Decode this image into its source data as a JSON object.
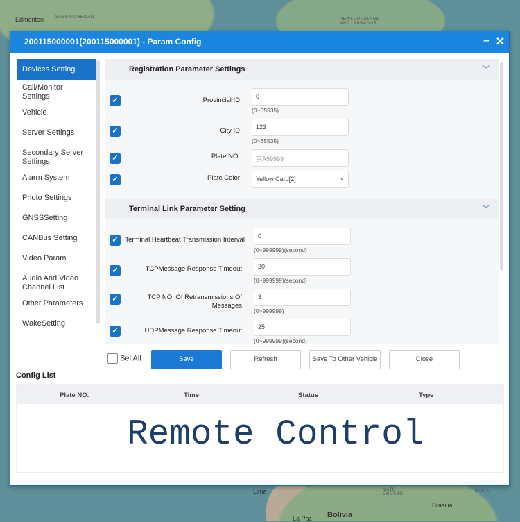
{
  "map": {
    "labels": [
      "Edmonton",
      "SASKATCHEWAN",
      "NEWFOUNDLAND AND LABRADOR",
      "Lima",
      "MATO GROSSO",
      "Brasilia",
      "Bolivia",
      "La Paz",
      "BAHIA"
    ]
  },
  "dialog": {
    "title": "200115000001(200115000001) - Param Config",
    "minimize": "–",
    "close": "✕"
  },
  "sidebar": {
    "items": [
      "Devices Setting",
      "Call/Monitor Settings",
      "Vehicle",
      "Server Settings",
      "Secondary Server Settings",
      "Alarm System",
      "Photo Settings",
      "GNSSSetting",
      "CANBus Setting",
      "Video Param",
      "Audio And Video Channel List",
      "Other Parameters",
      "WakeSetting"
    ]
  },
  "sections": [
    {
      "title": "Registration Parameter Settings",
      "fields": [
        {
          "label": "Provincial ID",
          "value": "0",
          "hint": "(0~65535)",
          "checked": true
        },
        {
          "label": "City ID",
          "value": "123",
          "hint": "(0~65535)",
          "checked": true
        },
        {
          "label": "Plate NO.",
          "value": "京A99999",
          "hint": "",
          "checked": true
        },
        {
          "label": "Plate Color",
          "value": "Yellow Card[2]",
          "hint": "",
          "checked": true
        }
      ]
    },
    {
      "title": "Terminal Link Parameter Setting",
      "fields": [
        {
          "label": "Terminal Heartbeat Transmission Interval",
          "value": "0",
          "hint": "(0~999999)(second)",
          "checked": true
        },
        {
          "label": "TCPMessage Response Timeout",
          "value": "20",
          "hint": "(0~999999)(second)",
          "checked": true
        },
        {
          "label": "TCP NO. Of Retransmissions Of Messages",
          "value": "3",
          "hint": "(0~999999)",
          "checked": true
        },
        {
          "label": "UDPMessage Response Timeout",
          "value": "25",
          "hint": "(0~999999)(second)",
          "checked": true
        }
      ]
    }
  ],
  "actions": {
    "sel_all": "Sel All",
    "save": "Save",
    "refresh": "Refresh",
    "save_other": "Save To Other Vehicle",
    "close": "Close"
  },
  "config_list": {
    "title": "Config List",
    "columns": [
      "Plate NO.",
      "Time",
      "Status",
      "Type"
    ]
  },
  "overlay": "Remote Control"
}
